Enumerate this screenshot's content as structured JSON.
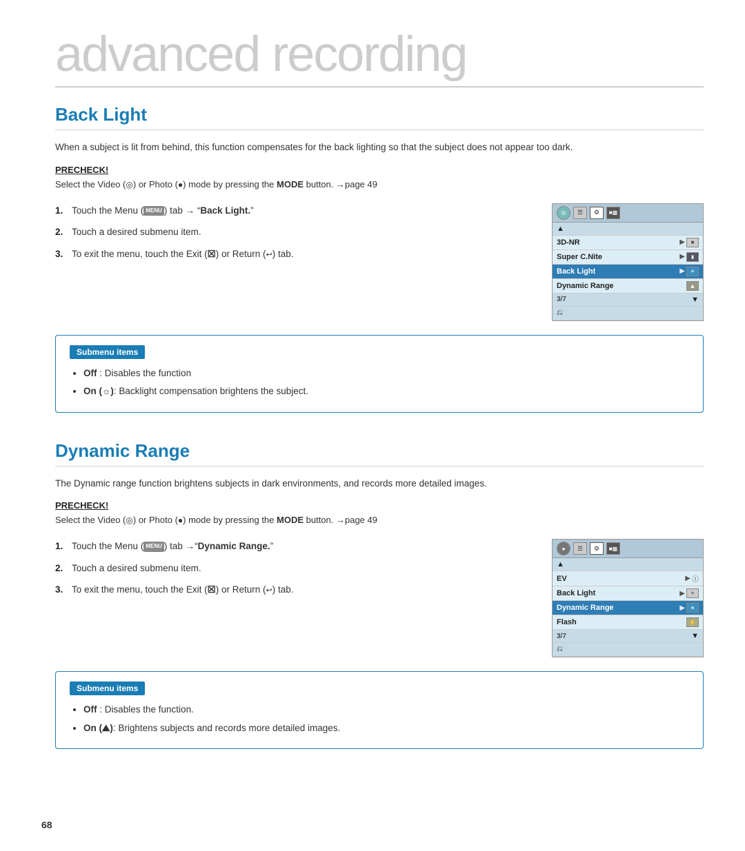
{
  "page": {
    "title": "advanced recording",
    "page_number": "68"
  },
  "section1": {
    "heading": "Back Light",
    "description": "When a subject is lit from behind, this function compensates for the back lighting so that the subject does not appear too dark.",
    "precheck_label": "PRECHECK!",
    "precheck_text": "Select the Video (°) or Photo (●) mode by pressing the MODE button. →page 49",
    "steps": [
      "Touch the Menu (□) tab → “Back Light.”",
      "Touch a desired submenu item.",
      "To exit the menu, touch the Exit (⨯) or Return (↩) tab."
    ],
    "submenu": {
      "title": "Submenu items",
      "items": [
        "Off : Disables the function",
        "On (☀️): Backlight compensation brightens the subject."
      ]
    },
    "menu_ui": {
      "rows": [
        {
          "label": "3D-NR",
          "val": "▶",
          "highlighted": false,
          "nav": false
        },
        {
          "label": "Super C.Nite",
          "val": "▶",
          "highlighted": false,
          "nav": false
        },
        {
          "label": "Back Light",
          "val": "▶",
          "highlighted": true,
          "nav": false
        },
        {
          "label": "Dynamic Range",
          "val": "",
          "highlighted": false,
          "nav": false
        }
      ],
      "page_indicator": "3/7"
    }
  },
  "section2": {
    "heading": "Dynamic Range",
    "description": "The Dynamic range function brightens subjects in dark environments, and records more detailed images.",
    "precheck_label": "PRECHECK!",
    "precheck_text": "Select the Video (°) or Photo (●) mode by pressing the MODE button. →page 49",
    "steps": [
      "Touch the Menu (□) tab →“Dynamic Range.”",
      "Touch a desired submenu item.",
      "To exit the menu, touch the Exit (⨯) or Return (↩) tab."
    ],
    "submenu": {
      "title": "Submenu items",
      "items": [
        "Off : Disables the function.",
        "On (☀): Brightens subjects and records more detailed images."
      ]
    },
    "menu_ui": {
      "rows": [
        {
          "label": "EV",
          "val": "▶",
          "highlighted": false,
          "nav": false
        },
        {
          "label": "Back Light",
          "val": "▶",
          "highlighted": false,
          "nav": false
        },
        {
          "label": "Dynamic Range",
          "val": "▶",
          "highlighted": true,
          "nav": false
        },
        {
          "label": "Flash",
          "val": "",
          "highlighted": false,
          "nav": false
        }
      ],
      "page_indicator": "3/7"
    }
  },
  "labels": {
    "precheck": "PRECHECK!",
    "submenu_items": "Submenu items",
    "step_bold_1a": "Back Light.",
    "step_bold_2a": "Dynamic Range.",
    "off_label": "Off",
    "off_desc1": " : Disables the function",
    "off_desc2": " : Disables the function.",
    "on_label1": "On (☀️)",
    "on_desc1": ": Backlight compensation brightens the subject.",
    "on_label2": "On (☀)",
    "on_desc2": ": Brightens subjects and records more detailed images.",
    "mode_label": "MODE",
    "page_ref": "→page 49"
  }
}
